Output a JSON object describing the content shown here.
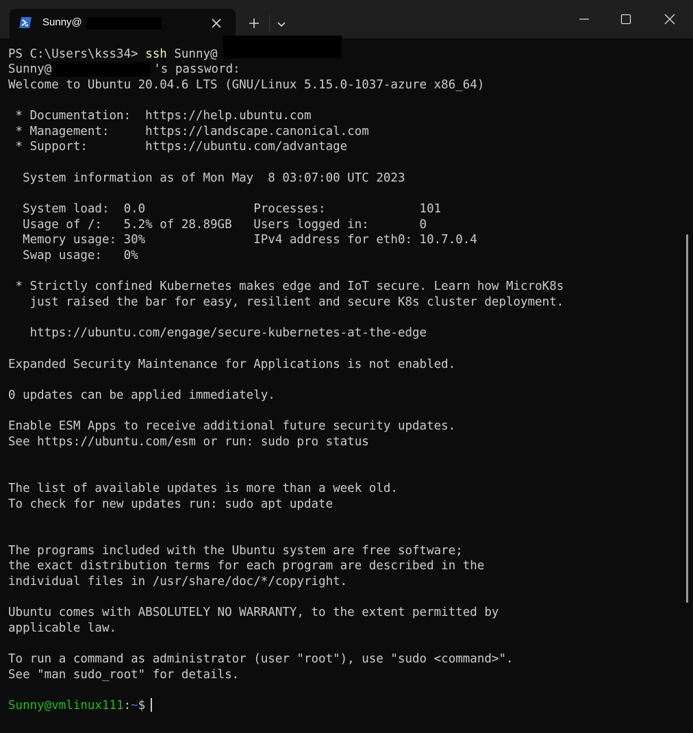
{
  "tab": {
    "title": "Sunny@",
    "icon": "powershell-icon",
    "close_icon": "close-icon",
    "new_tab_icon": "plus-icon",
    "dropdown_icon": "chevron-down-icon"
  },
  "window_controls": {
    "minimize_icon": "minimize-icon",
    "maximize_icon": "maximize-icon",
    "close_icon": "close-icon"
  },
  "colors": {
    "background": "#0c0c0c",
    "titlebar": "#1f1f1f",
    "text": "#cccccc",
    "command": "#f9f1a5",
    "prompt_user": "#16c60c",
    "prompt_path": "#3b78ff"
  },
  "terminal": {
    "ps_prompt": "PS C:\\Users\\kss34> ",
    "ssh_command": "ssh",
    "ssh_args": " Sunny@",
    "password_user": "Sunny@",
    "password_suffix": "'s password:",
    "lines": [
      "Welcome to Ubuntu 20.04.6 LTS (GNU/Linux 5.15.0-1037-azure x86_64)",
      " * Documentation:  https://help.ubuntu.com",
      " * Management:     https://landscape.canonical.com",
      " * Support:        https://ubuntu.com/advantage",
      "  System information as of Mon May  8 03:07:00 UTC 2023",
      "  System load:  0.0               Processes:             101",
      "  Usage of /:   5.2% of 28.89GB   Users logged in:       0",
      "  Memory usage: 30%               IPv4 address for eth0: 10.7.0.4",
      "  Swap usage:   0%",
      " * Strictly confined Kubernetes makes edge and IoT secure. Learn how MicroK8s",
      "   just raised the bar for easy, resilient and secure K8s cluster deployment.",
      "   https://ubuntu.com/engage/secure-kubernetes-at-the-edge",
      "Expanded Security Maintenance for Applications is not enabled.",
      "0 updates can be applied immediately.",
      "Enable ESM Apps to receive additional future security updates.",
      "See https://ubuntu.com/esm or run: sudo pro status",
      "The list of available updates is more than a week old.",
      "To check for new updates run: sudo apt update",
      "The programs included with the Ubuntu system are free software;",
      "the exact distribution terms for each program are described in the",
      "individual files in /usr/share/doc/*/copyright.",
      "Ubuntu comes with ABSOLUTELY NO WARRANTY, to the extent permitted by",
      "applicable law.",
      "To run a command as administrator (user \"root\"), use \"sudo <command>\".",
      "See \"man sudo_root\" for details."
    ],
    "prompt": {
      "user_host": "Sunny@vmlinux111",
      "separator": ":",
      "path": "~",
      "symbol": "$"
    }
  }
}
